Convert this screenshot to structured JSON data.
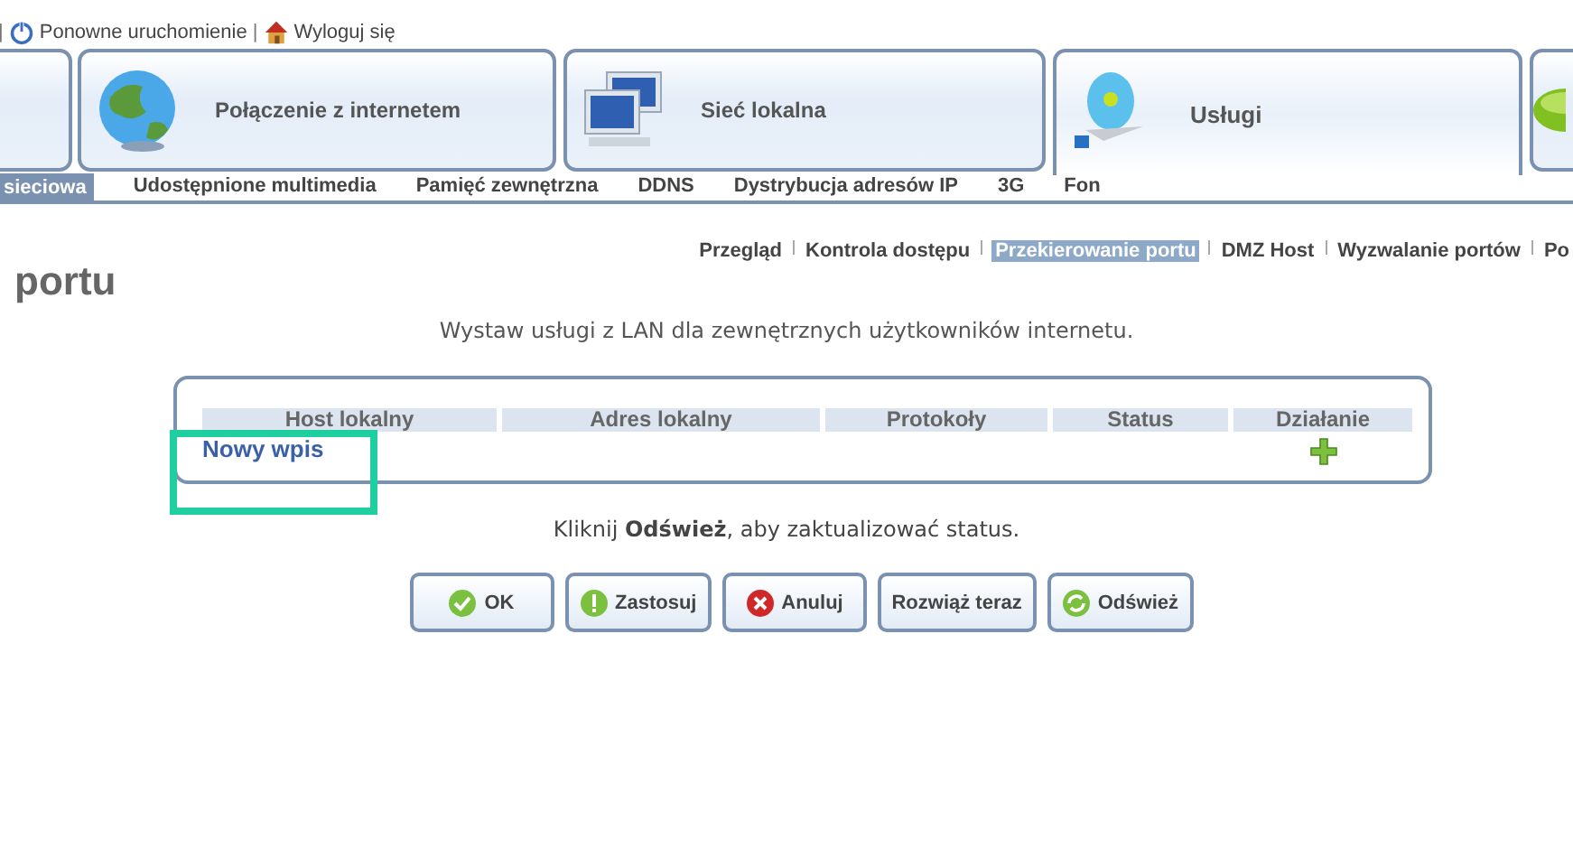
{
  "top_links": [
    {
      "kind": "separator",
      "label": "|"
    },
    {
      "kind": "restart",
      "label": "Ponowne uruchomienie"
    },
    {
      "kind": "separator",
      "label": "|"
    },
    {
      "kind": "logout",
      "label": "Wyloguj się"
    }
  ],
  "main_tabs": [
    {
      "kind": "blank",
      "selected": false
    },
    {
      "kind": "globe",
      "label": "Połączenie z internetem",
      "selected": false
    },
    {
      "kind": "network",
      "label": "Sieć lokalna",
      "selected": false
    },
    {
      "kind": "disc",
      "label": "Usługi",
      "selected": true
    },
    {
      "kind": "partial",
      "selected": false
    }
  ],
  "sub_tabs": [
    {
      "label": "sieciowa",
      "selected": true
    },
    {
      "label": "Udostępnione multimedia",
      "selected": false
    },
    {
      "label": "Pamięć zewnętrzna",
      "selected": false
    },
    {
      "label": "DDNS",
      "selected": false
    },
    {
      "label": "Dystrybucja adresów IP",
      "selected": false
    },
    {
      "label": "3G",
      "selected": false
    },
    {
      "label": "Fon",
      "selected": false
    }
  ],
  "page_links": [
    {
      "label": "Przegląd",
      "selected": false
    },
    {
      "label": "Kontrola dostępu",
      "selected": false
    },
    {
      "label": "Przekierowanie portu",
      "selected": true
    },
    {
      "label": "DMZ Host",
      "selected": false
    },
    {
      "label": "Wyzwalanie portów",
      "selected": false
    },
    {
      "label": "Po",
      "selected": false
    }
  ],
  "page_title": "portu",
  "description": "Wystaw usługi z LAN dla zewnętrznych użytkowników internetu.",
  "table": {
    "columns": [
      "Host lokalny",
      "Adres lokalny",
      "Protokoły",
      "Status",
      "Działanie"
    ],
    "new_entry": "Nowy wpis"
  },
  "status_note": "Kliknij **Odśwież**, aby zaktualizować status.",
  "buttons": [
    {
      "kind": "ok",
      "label": "OK"
    },
    {
      "kind": "apply",
      "label": "Zastosuj"
    },
    {
      "kind": "cancel",
      "label": "Anuluj"
    },
    {
      "kind": "none",
      "label": "Rozwiąż teraz"
    },
    {
      "kind": "refresh",
      "label": "Odśwież"
    }
  ]
}
